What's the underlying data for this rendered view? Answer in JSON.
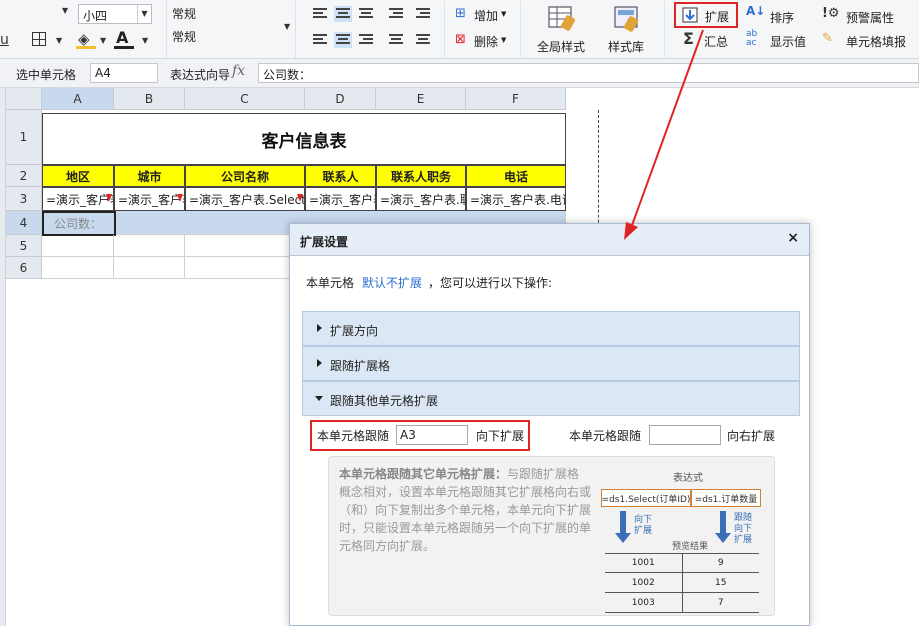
{
  "ribbon": {
    "font_size": "小四",
    "number_format_top": "常规",
    "number_format_value": "常规",
    "add_label": "增加",
    "delete_label": "删除",
    "global_style_label": "全局样式",
    "style_library_label": "样式库",
    "expand_label": "扩展",
    "summary_label": "汇总",
    "sort_label": "排序",
    "display_value_label": "显示值",
    "warning_label": "预警属性",
    "cell_fill_label": "单元格填报",
    "underline_glyph": "u",
    "font_color_glyph": "A",
    "sum_glyph": "Σ"
  },
  "formula_bar": {
    "selected_cell_label": "选中单元格",
    "cell_ref": "A4",
    "wizard_label": "表达式向导",
    "fx": "fx",
    "content": "公司数："
  },
  "sheet": {
    "columns": [
      "A",
      "B",
      "C",
      "D",
      "E",
      "F"
    ],
    "rows": [
      "1",
      "2",
      "3",
      "4",
      "5",
      "6"
    ],
    "title": "客户信息表",
    "headers": [
      "地区",
      "城市",
      "公司名称",
      "联系人",
      "联系人职务",
      "电话"
    ],
    "formulas": [
      "=演示_客户表",
      "=演示_客户表",
      "=演示_客户表.Select(",
      "=演示_客户表",
      "=演示_客户表.联",
      "=演示_客户表.电话"
    ],
    "a4_text": "公司数："
  },
  "dialog": {
    "title": "扩展设置",
    "close": "×",
    "desc_prefix": "本单元格",
    "desc_link": "默认不扩展",
    "desc_suffix": "，您可以进行以下操作:",
    "sections": [
      "扩展方向",
      "跟随扩展格",
      "跟随其他单元格扩展"
    ],
    "follow_label_1": "本单元格跟随",
    "follow_value_1": "A3",
    "follow_dir_1": "向下扩展",
    "follow_label_2": "本单元格跟随",
    "follow_value_2": "",
    "follow_dir_2": "向右扩展",
    "help_title": "本单元格跟随其它单元格扩展：",
    "help_body": "与跟随扩展格概念相对，设置本单元格跟随其它扩展格向右或（和）向下复制出多个单元格，本单元向下扩展时，只能设置本单元格跟随另一个向下扩展的单元格同方向扩展。",
    "diagram": {
      "title": "表达式",
      "cell_1": "=ds1.Select(订单ID)",
      "cell_2": "=ds1.订单数量",
      "arrow_1_line1": "向下",
      "arrow_1_line2": "扩展",
      "arrow_2_line1": "跟随",
      "arrow_2_line2": "向下",
      "arrow_2_line3": "扩展",
      "preview_label": "预览结果",
      "rows": [
        [
          "1001",
          "9"
        ],
        [
          "1002",
          "15"
        ],
        [
          "1003",
          "7"
        ]
      ]
    }
  },
  "colors": {
    "accent": "#2b6fd0",
    "highlight": "#e02424",
    "header_fill": "#ffff00",
    "selection": "#c8d9ee"
  }
}
